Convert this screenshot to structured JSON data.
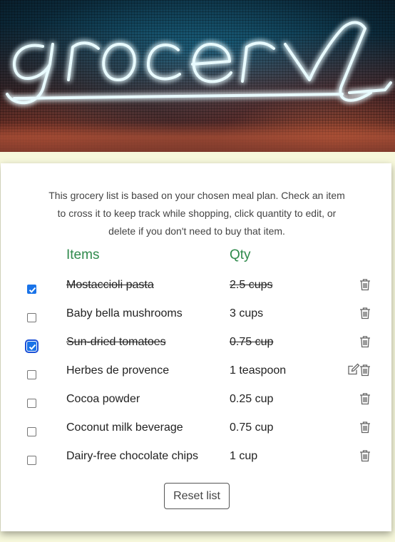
{
  "hero": {
    "sign_text": "grocery"
  },
  "intro": "This grocery list is based on your chosen meal plan. Check an item to cross it to keep track while shopping, click quantity to edit, or delete if you don't need to buy that item.",
  "columns": {
    "items": "Items",
    "qty": "Qty"
  },
  "items": [
    {
      "name": "Mostaccioli pasta",
      "qty": "2.5 cups",
      "checked": true
    },
    {
      "name": "Baby bella mushrooms",
      "qty": "3 cups",
      "checked": false
    },
    {
      "name": "Sun-dried tomatoes",
      "qty": "0.75 cup",
      "checked": true
    },
    {
      "name": "Herbes de provence",
      "qty": "1 teaspoon",
      "checked": false
    },
    {
      "name": "Cocoa powder",
      "qty": "0.25 cup",
      "checked": false
    },
    {
      "name": "Coconut milk beverage",
      "qty": "0.75 cup",
      "checked": false
    },
    {
      "name": "Dairy-free chocolate chips",
      "qty": "1 cup",
      "checked": false
    }
  ],
  "reset_label": "Reset list",
  "colors": {
    "accent": "#2f8a4c",
    "checkbox": "#1a73e8",
    "page_bg": "#f7f8dc"
  }
}
